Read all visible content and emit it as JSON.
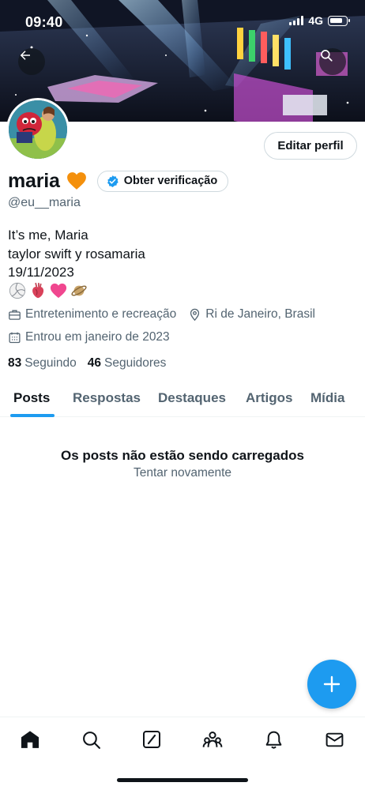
{
  "status_bar": {
    "time": "09:40",
    "network": "4G"
  },
  "header": {
    "back_icon": "arrow-left-icon",
    "search_icon": "search-icon"
  },
  "profile": {
    "name": "maria",
    "name_emoji": "orange-heart",
    "verify_label": "Obter verificação",
    "edit_label": "Editar perfil",
    "handle": "@eu__maria",
    "bio_lines": [
      "It’s me, Maria",
      "taylor swift y rosamaria",
      "19/11/2023"
    ],
    "bio_emojis": [
      "volleyball",
      "anatomical-heart",
      "pink-heart",
      "ringed-planet"
    ],
    "category": "Entretenimento e recreação",
    "location": "Ri de Janeiro, Brasil",
    "joined": "Entrou em janeiro de 2023",
    "following_count": "83",
    "following_label": "Seguindo",
    "followers_count": "46",
    "followers_label": "Seguidores"
  },
  "tabs": [
    "Posts",
    "Respostas",
    "Destaques",
    "Artigos",
    "Mídia"
  ],
  "active_tab": "Posts",
  "empty_state": {
    "title": "Os posts não estão sendo carregados",
    "retry": "Tentar novamente"
  },
  "fab_icon": "plus-icon",
  "bottom_nav": [
    "home-icon",
    "search-icon",
    "grok-icon",
    "communities-icon",
    "notifications-icon",
    "messages-icon"
  ],
  "colors": {
    "accent": "#1d9bf0",
    "text": "#0f1419",
    "muted": "#536471",
    "border": "#cfd9de",
    "heart": "#f4900c"
  }
}
